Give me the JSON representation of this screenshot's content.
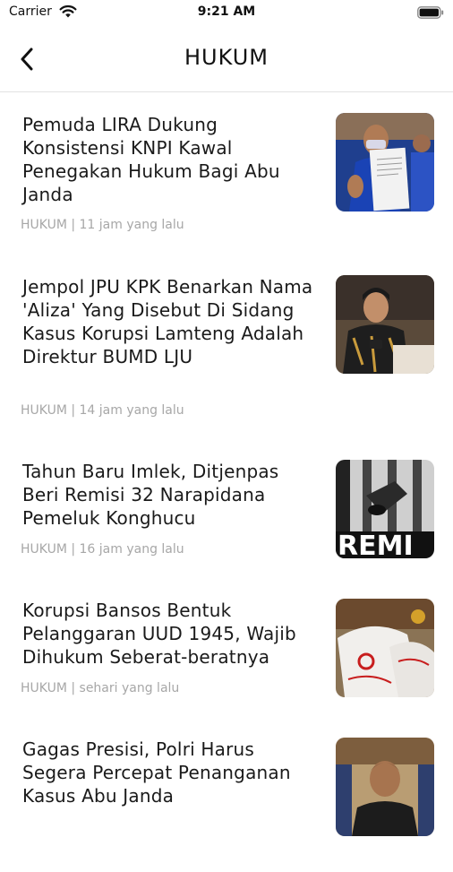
{
  "status_bar": {
    "carrier": "Carrier",
    "time": "9:21 AM",
    "wifi_icon": "wifi-icon",
    "battery_icon": "battery-icon"
  },
  "nav": {
    "back_icon": "chevron-left-icon",
    "title": "HUKUM"
  },
  "articles": [
    {
      "title": "Pemuda LIRA Dukung Konsistensi KNPI Kawal Penegakan Hukum Bagi Abu Janda",
      "category": "HUKUM",
      "time": "11 jam yang lalu",
      "meta": "HUKUM | 11 jam yang lalu"
    },
    {
      "title": "Jempol JPU KPK Benarkan Nama 'Aliza' Yang Disebut Di Sidang Kasus Korupsi Lamteng Adalah Direktur BUMD LJU",
      "category": "HUKUM",
      "time": "14 jam yang lalu",
      "meta": "HUKUM | 14 jam yang lalu"
    },
    {
      "title": "Tahun Baru Imlek, Ditjenpas Beri Remisi 32 Narapidana Pemeluk Konghucu",
      "category": "HUKUM",
      "time": "16 jam yang lalu",
      "meta": "HUKUM | 16 jam yang lalu",
      "thumb_text": "REMI"
    },
    {
      "title": "Korupsi Bansos Bentuk Pelanggaran UUD 1945, Wajib Dihukum Seberat-beratnya",
      "category": "HUKUM",
      "time": "sehari yang lalu",
      "meta": "HUKUM | sehari yang lalu"
    },
    {
      "title": "Gagas Presisi, Polri Harus Segera Percepat Penanganan Kasus Abu Janda",
      "category": "HUKUM",
      "time": "",
      "meta": ""
    }
  ],
  "colors": {
    "text": "#1a1a1a",
    "meta": "#a7a7a7",
    "divider": "#e2e2e2"
  }
}
